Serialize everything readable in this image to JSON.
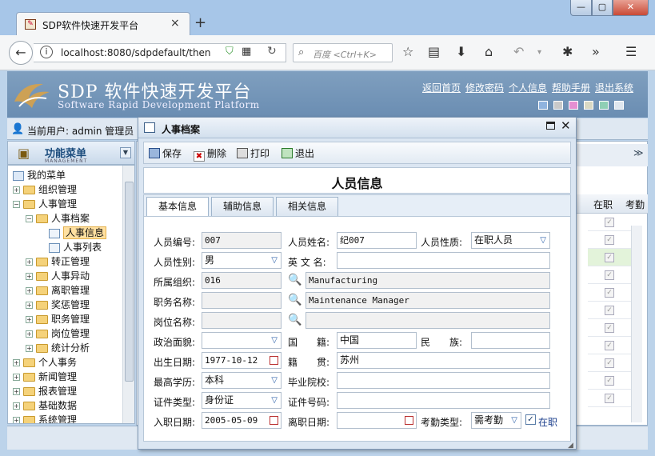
{
  "browser": {
    "tab_title": "SDP软件快速开发平台",
    "tab_close": "×",
    "new_tab": "+",
    "url": "localhost:8080/sdpdefault/then",
    "search_placeholder": "百度 <Ctrl+K>",
    "window_min": "—",
    "window_max": "▢",
    "window_close": "✕"
  },
  "app": {
    "brand": "SDP 软件快速开发平台",
    "brand_en": "Software Rapid Development Platform",
    "header_links": [
      "返回首页",
      "修改密码",
      "个人信息",
      "帮助手册",
      "退出系统"
    ],
    "theme_swatches": [
      "#8fb3de",
      "#c9c9c9",
      "#e48fd2",
      "#d9d9c4",
      "#8fcfb5",
      "#dfe7ef"
    ],
    "current_user": "当前用户: admin 管理员"
  },
  "menu": {
    "title": "功能菜单",
    "subtitle": "MANAGEMENT",
    "root": "我的菜单",
    "items": [
      {
        "label": "组织管理",
        "level": 1,
        "expander": "+",
        "icon": "folder"
      },
      {
        "label": "人事管理",
        "level": 1,
        "expander": "−",
        "icon": "folder"
      },
      {
        "label": "人事档案",
        "level": 2,
        "expander": "−",
        "icon": "folder"
      },
      {
        "label": "人事信息",
        "level": 3,
        "expander": "",
        "icon": "page",
        "selected": true
      },
      {
        "label": "人事列表",
        "level": 3,
        "expander": "",
        "icon": "page"
      },
      {
        "label": "转正管理",
        "level": 2,
        "expander": "+",
        "icon": "folder"
      },
      {
        "label": "人事异动",
        "level": 2,
        "expander": "+",
        "icon": "folder"
      },
      {
        "label": "离职管理",
        "level": 2,
        "expander": "+",
        "icon": "folder"
      },
      {
        "label": "奖惩管理",
        "level": 2,
        "expander": "+",
        "icon": "folder"
      },
      {
        "label": "职务管理",
        "level": 2,
        "expander": "+",
        "icon": "folder"
      },
      {
        "label": "岗位管理",
        "level": 2,
        "expander": "+",
        "icon": "folder"
      },
      {
        "label": "统计分析",
        "level": 2,
        "expander": "+",
        "icon": "folder"
      },
      {
        "label": "个人事务",
        "level": 1,
        "expander": "+",
        "icon": "folder"
      },
      {
        "label": "新闻管理",
        "level": 1,
        "expander": "+",
        "icon": "folder"
      },
      {
        "label": "报表管理",
        "level": 1,
        "expander": "+",
        "icon": "folder"
      },
      {
        "label": "基础数据",
        "level": 1,
        "expander": "+",
        "icon": "folder"
      },
      {
        "label": "系统管理",
        "level": 1,
        "expander": "+",
        "icon": "folder"
      }
    ]
  },
  "grid": {
    "columns": [
      "在职",
      "考勤"
    ]
  },
  "dialog": {
    "title": "人事档案",
    "toolbar": {
      "save": "保存",
      "delete": "删除",
      "print": "打印",
      "exit": "退出"
    },
    "heading": "人员信息",
    "tabs": [
      "基本信息",
      "辅助信息",
      "相关信息"
    ],
    "active_tab": "基本信息",
    "form": {
      "emp_no": {
        "label": "人员编号:",
        "value": "007"
      },
      "emp_name": {
        "label": "人员姓名:",
        "value": "纪007"
      },
      "emp_nature": {
        "label": "人员性质:",
        "value": "在职人员"
      },
      "gender": {
        "label": "人员性别:",
        "value": "男"
      },
      "eng_name": {
        "label": "英 文 名:",
        "value": ""
      },
      "org": {
        "label": "所属组织:",
        "code": "016",
        "name": "Manufacturing"
      },
      "title": {
        "label": "职务名称:",
        "code": "",
        "name": "Maintenance Manager"
      },
      "post": {
        "label": "岗位名称:",
        "code": "",
        "name": ""
      },
      "politics": {
        "label": "政治面貌:",
        "value": ""
      },
      "country": {
        "label": "国　　籍:",
        "value": "中国"
      },
      "ethnicity": {
        "label": "民　　族:",
        "value": ""
      },
      "birth": {
        "label": "出生日期:",
        "value": "1977-10-12"
      },
      "native": {
        "label": "籍　　贯:",
        "value": "苏州"
      },
      "education": {
        "label": "最高学历:",
        "value": "本科"
      },
      "school": {
        "label": "毕业院校:",
        "value": ""
      },
      "id_type": {
        "label": "证件类型:",
        "value": "身份证"
      },
      "id_no": {
        "label": "证件号码:",
        "value": ""
      },
      "hire_date": {
        "label": "入职日期:",
        "value": "2005-05-09"
      },
      "leave_date": {
        "label": "离职日期:",
        "value": ""
      },
      "attendance": {
        "label": "考勤类型:",
        "value": "需考勤"
      },
      "on_job": {
        "label": "在职",
        "checked": true
      }
    }
  }
}
